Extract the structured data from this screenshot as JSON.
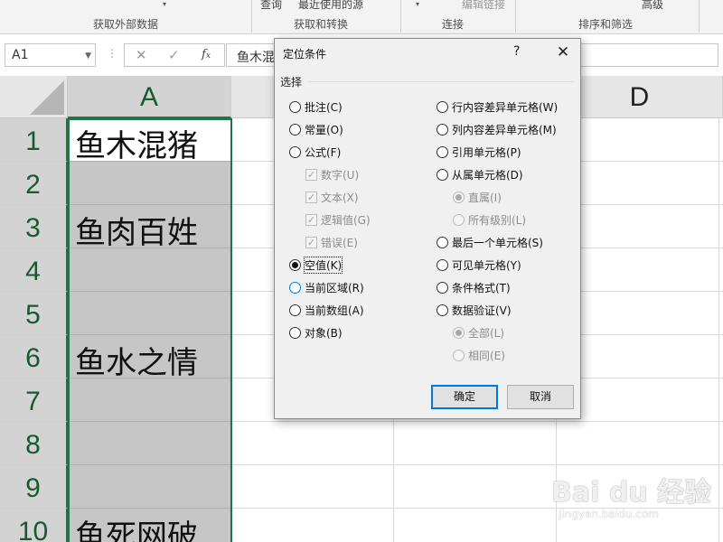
{
  "ribbon": {
    "groups": [
      "获取外部数据",
      "获取和转换",
      "连接",
      "排序和筛选"
    ],
    "top_items": [
      "查询",
      "最近使用的源",
      "编辑链接",
      "高级"
    ]
  },
  "formula_bar": {
    "name_box": "A1",
    "content": "鱼木混猪",
    "fx_icon": "fx-icon",
    "cancel_icon": "x-icon",
    "enter_icon": "check-icon"
  },
  "sheet": {
    "columns": [
      "A",
      "D"
    ],
    "rows": [
      "1",
      "2",
      "3",
      "4",
      "5",
      "6",
      "7",
      "8",
      "9",
      "10"
    ],
    "cells": {
      "A1": "鱼木混猪",
      "A3": "鱼肉百姓",
      "A6": "鱼水之情",
      "A10": "鱼死网破"
    },
    "selection_color": "#217346"
  },
  "dialog": {
    "title": "定位条件",
    "help": "?",
    "close_icon": "close-icon",
    "group_label": "选择",
    "left_options": [
      {
        "label": "批注(C)",
        "type": "radio",
        "checked": false,
        "disabled": false
      },
      {
        "label": "常量(O)",
        "type": "radio",
        "checked": false,
        "disabled": false
      },
      {
        "label": "公式(F)",
        "type": "radio",
        "checked": false,
        "disabled": false
      },
      {
        "label": "数字(U)",
        "type": "checkbox",
        "checked": true,
        "disabled": true
      },
      {
        "label": "文本(X)",
        "type": "checkbox",
        "checked": true,
        "disabled": true
      },
      {
        "label": "逻辑值(G)",
        "type": "checkbox",
        "checked": true,
        "disabled": true
      },
      {
        "label": "错误(E)",
        "type": "checkbox",
        "checked": true,
        "disabled": true
      },
      {
        "label": "空值(K)",
        "type": "radio",
        "checked": true,
        "disabled": false
      },
      {
        "label": "当前区域(R)",
        "type": "radio",
        "checked": false,
        "disabled": false
      },
      {
        "label": "当前数组(A)",
        "type": "radio",
        "checked": false,
        "disabled": false
      },
      {
        "label": "对象(B)",
        "type": "radio",
        "checked": false,
        "disabled": false
      }
    ],
    "right_options": [
      {
        "label": "行内容差异单元格(W)",
        "type": "radio",
        "checked": false,
        "disabled": false
      },
      {
        "label": "列内容差异单元格(M)",
        "type": "radio",
        "checked": false,
        "disabled": false
      },
      {
        "label": "引用单元格(P)",
        "type": "radio",
        "checked": false,
        "disabled": false
      },
      {
        "label": "从属单元格(D)",
        "type": "radio",
        "checked": false,
        "disabled": false
      },
      {
        "label": "直属(I)",
        "type": "radio",
        "checked": true,
        "disabled": true
      },
      {
        "label": "所有级别(L)",
        "type": "radio",
        "checked": false,
        "disabled": true
      },
      {
        "label": "最后一个单元格(S)",
        "type": "radio",
        "checked": false,
        "disabled": false
      },
      {
        "label": "可见单元格(Y)",
        "type": "radio",
        "checked": false,
        "disabled": false
      },
      {
        "label": "条件格式(T)",
        "type": "radio",
        "checked": false,
        "disabled": false
      },
      {
        "label": "数据验证(V)",
        "type": "radio",
        "checked": false,
        "disabled": false
      },
      {
        "label": "全部(L)",
        "type": "radio",
        "checked": true,
        "disabled": true
      },
      {
        "label": "相同(E)",
        "type": "radio",
        "checked": false,
        "disabled": true
      }
    ],
    "ok_label": "确定",
    "cancel_label": "取消"
  },
  "watermark": {
    "brand": "Bai du 经验",
    "url": "jingyan.baidu.com"
  }
}
